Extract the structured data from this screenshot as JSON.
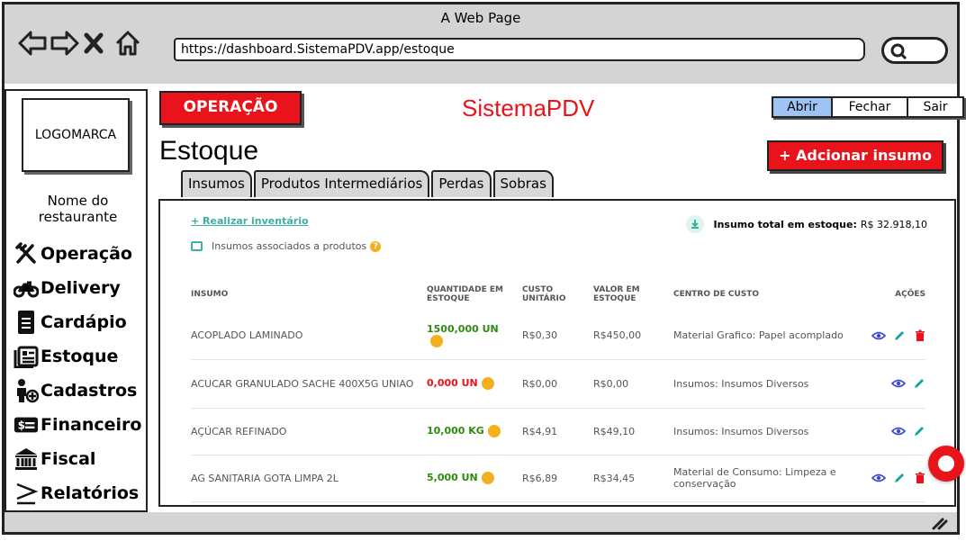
{
  "window": {
    "title": "A Web Page",
    "url": "https://dashboard.SistemaPDV.app/estoque"
  },
  "sidebar": {
    "logo": "LOGOMARCA",
    "restaurant_name": "Nome do restaurante",
    "items": [
      {
        "label": "Operação",
        "icon": "fork-knife-icon"
      },
      {
        "label": "Delivery",
        "icon": "motorcycle-icon"
      },
      {
        "label": "Cardápio",
        "icon": "document-icon"
      },
      {
        "label": "Estoque",
        "icon": "inventory-icon"
      },
      {
        "label": "Cadastros",
        "icon": "user-add-icon"
      },
      {
        "label": "Financeiro",
        "icon": "money-icon"
      },
      {
        "label": "Fiscal",
        "icon": "bank-icon"
      },
      {
        "label": "Relatórios",
        "icon": "greater-equal-icon"
      }
    ]
  },
  "header": {
    "badge": "OPERAÇÃO",
    "app_title": "SistemaPDV",
    "buttons": [
      "Abrir",
      "Fechar",
      "Sair"
    ],
    "accent": "#e8131b"
  },
  "page": {
    "title": "Estoque",
    "add_button": "+ Adcionar insumo",
    "tabs": [
      "Insumos",
      "Produtos Intermediários",
      "Perdas",
      "Sobras"
    ],
    "inventory_link": "+ Realizar inventário",
    "total_label": "Insumo total em estoque:",
    "total_value": "R$ 32.918,10",
    "assoc_label": "Insumos associados a produtos",
    "columns": [
      "INSUMO",
      "QUANTIDADE EM ESTOQUE",
      "CUSTO UNITÁRIO",
      "VALOR EM ESTOQUE",
      "CENTRO DE CUSTO",
      "AÇÕES"
    ],
    "rows": [
      {
        "insumo": "ACOPLADO LAMINADO",
        "qty": "1500,000 UN",
        "qty_status": "green",
        "custo": "R$0,30",
        "valor": "R$450,00",
        "centro": "Material Grafico: Papel acomplado",
        "delete": true
      },
      {
        "insumo": "ACUCAR GRANULADO SACHE 400X5G UNIAO",
        "qty": "0,000 UN",
        "qty_status": "red",
        "custo": "R$0,00",
        "valor": "R$0,00",
        "centro": "Insumos: Insumos Diversos",
        "delete": false
      },
      {
        "insumo": "AÇÚCAR REFINADO",
        "qty": "10,000 KG",
        "qty_status": "green",
        "custo": "R$4,91",
        "valor": "R$49,10",
        "centro": "Insumos: Insumos Diversos",
        "delete": false
      },
      {
        "insumo": "AG SANITARIA GOTA LIMPA 2L",
        "qty": "5,000 UN",
        "qty_status": "green",
        "custo": "R$6,89",
        "valor": "R$34,45",
        "centro": "Material de Consumo: Limpeza e conservação",
        "delete": true
      }
    ]
  }
}
